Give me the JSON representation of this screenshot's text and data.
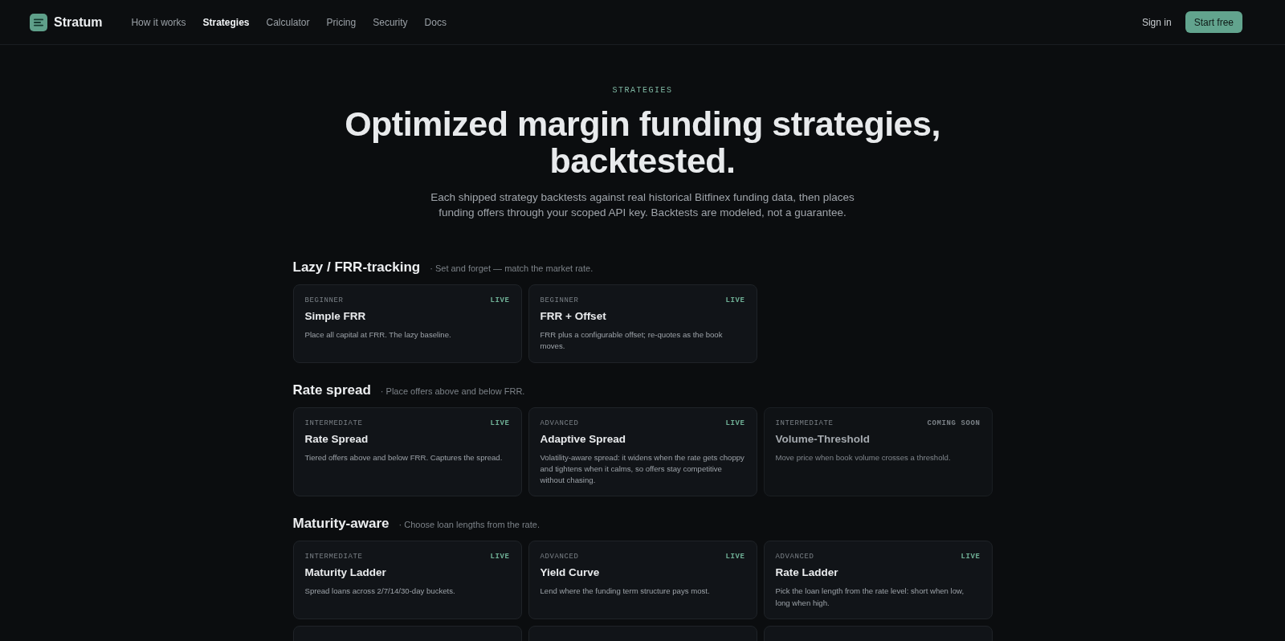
{
  "header": {
    "brand": "Stratum",
    "nav": [
      {
        "label": "How it works",
        "selected": false
      },
      {
        "label": "Strategies",
        "selected": true
      },
      {
        "label": "Calculator",
        "selected": false
      },
      {
        "label": "Pricing",
        "selected": false
      },
      {
        "label": "Security",
        "selected": false
      },
      {
        "label": "Docs",
        "selected": false
      }
    ],
    "sign_in": "Sign in",
    "cta": "Start free"
  },
  "hero": {
    "eyebrow": "STRATEGIES",
    "title_lines": [
      "Optimized margin funding strategies,",
      "backtested."
    ],
    "subtitle_lines": [
      "Each shipped strategy backtests against real historical Bitfinex funding data, then places",
      "funding offers through your scoped API key. Backtests are modeled, not a guarantee."
    ]
  },
  "sections": [
    {
      "title": "Lazy / FRR-tracking",
      "subtitle": "· Set and forget — match the market rate.",
      "cards": [
        {
          "kind": "strategy",
          "level": "BEGINNER",
          "status": "LIVE",
          "live": true,
          "name": "Simple FRR",
          "description": "Place all capital at FRR. The lazy baseline."
        },
        {
          "kind": "strategy",
          "level": "BEGINNER",
          "status": "LIVE",
          "live": true,
          "name": "FRR + Offset",
          "description": "FRR plus a configurable offset; re-quotes as the book moves."
        }
      ]
    },
    {
      "title": "Rate spread",
      "subtitle": "· Place offers above and below FRR.",
      "cards": [
        {
          "kind": "strategy",
          "level": "INTERMEDIATE",
          "status": "LIVE",
          "live": true,
          "name": "Rate Spread",
          "description": "Tiered offers above and below FRR. Captures the spread."
        },
        {
          "kind": "strategy",
          "level": "ADVANCED",
          "status": "LIVE",
          "live": true,
          "name": "Adaptive Spread",
          "description": "Volatility-aware spread: it widens when the rate gets choppy and tightens when it calms, so offers stay competitive without chasing."
        },
        {
          "kind": "strategy",
          "level": "INTERMEDIATE",
          "status": "COMING SOON",
          "live": false,
          "name": "Volume-Threshold",
          "description": "Move price when book volume crosses a threshold."
        }
      ]
    },
    {
      "title": "Maturity-aware",
      "subtitle": "· Choose loan lengths from the rate.",
      "cards": [
        {
          "kind": "strategy",
          "level": "INTERMEDIATE",
          "status": "LIVE",
          "live": true,
          "name": "Maturity Ladder",
          "description": "Spread loans across 2/7/14/30-day buckets."
        },
        {
          "kind": "strategy",
          "level": "ADVANCED",
          "status": "LIVE",
          "live": true,
          "name": "Yield Curve",
          "description": "Lend where the funding term structure pays most."
        },
        {
          "kind": "strategy",
          "level": "ADVANCED",
          "status": "LIVE",
          "live": true,
          "name": "Rate Ladder",
          "description": "Pick the loan length from the rate level: short when low, long when high."
        },
        {
          "kind": "clipped"
        },
        {
          "kind": "clipped"
        },
        {
          "kind": "clipped"
        }
      ]
    }
  ]
}
